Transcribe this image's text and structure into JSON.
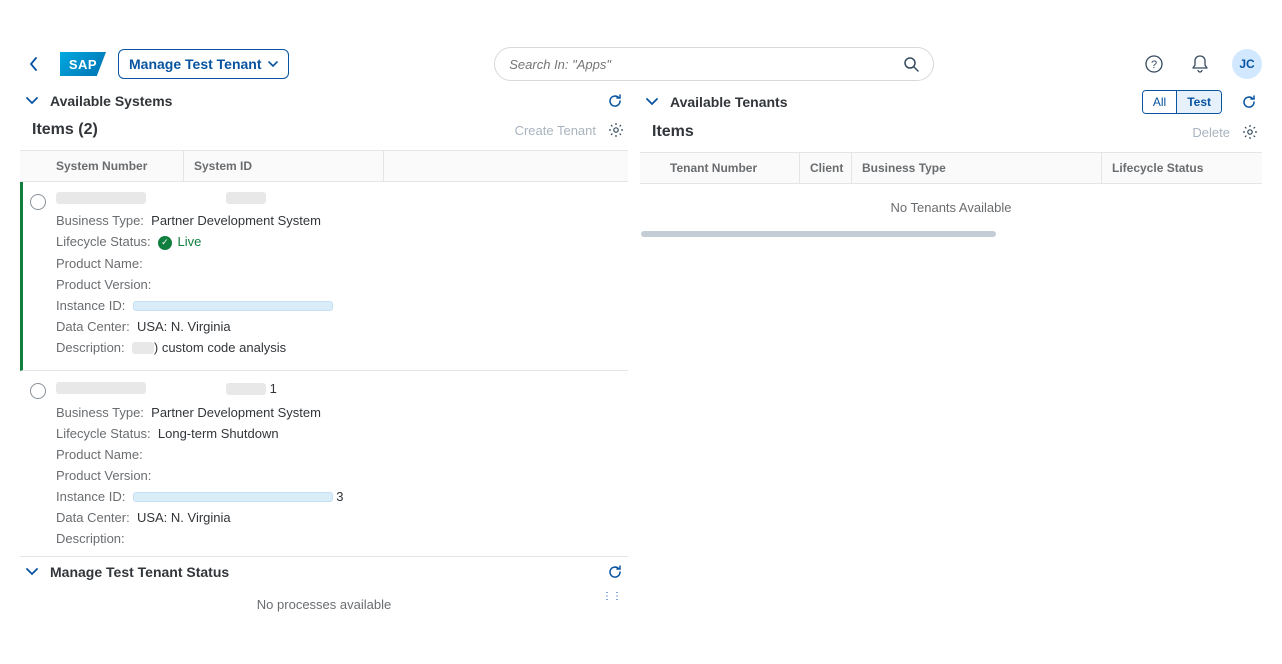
{
  "header": {
    "logo": "SAP",
    "app_title": "Manage Test Tenant",
    "search_placeholder": "Search In: \"Apps\"",
    "avatar_initials": "JC"
  },
  "left": {
    "panel_title": "Available Systems",
    "items_title": "Items (2)",
    "create_tenant": "Create Tenant",
    "columns": {
      "c1": "System Number",
      "c2": "System ID"
    },
    "labels": {
      "business_type": "Business Type:",
      "lifecycle": "Lifecycle Status:",
      "product_name": "Product Name:",
      "product_version": "Product Version:",
      "instance_id": "Instance ID:",
      "data_center": "Data Center:",
      "description": "Description:"
    },
    "rows": [
      {
        "business_type": "Partner Development System",
        "lifecycle": "Live",
        "live_icon": true,
        "product_name": "",
        "product_version": "",
        "instance_id_redacted": true,
        "data_center": "USA: N. Virginia",
        "description_suffix": ") custom code analysis"
      },
      {
        "system_id_suffix": "1",
        "business_type": "Partner Development System",
        "lifecycle": "Long-term Shutdown",
        "product_name": "",
        "product_version": "",
        "instance_id_redacted": true,
        "instance_id_suffix": "3",
        "data_center": "USA: N. Virginia",
        "description": ""
      }
    ],
    "status": {
      "title": "Manage Test Tenant Status",
      "empty": "No processes available"
    }
  },
  "right": {
    "panel_title": "Available Tenants",
    "seg": {
      "all": "All",
      "test": "Test"
    },
    "items_title": "Items",
    "delete": "Delete",
    "columns": {
      "c1": "Tenant Number",
      "c2": "Client",
      "c3": "Business Type",
      "c4": "Lifecycle Status"
    },
    "empty": "No Tenants Available"
  }
}
